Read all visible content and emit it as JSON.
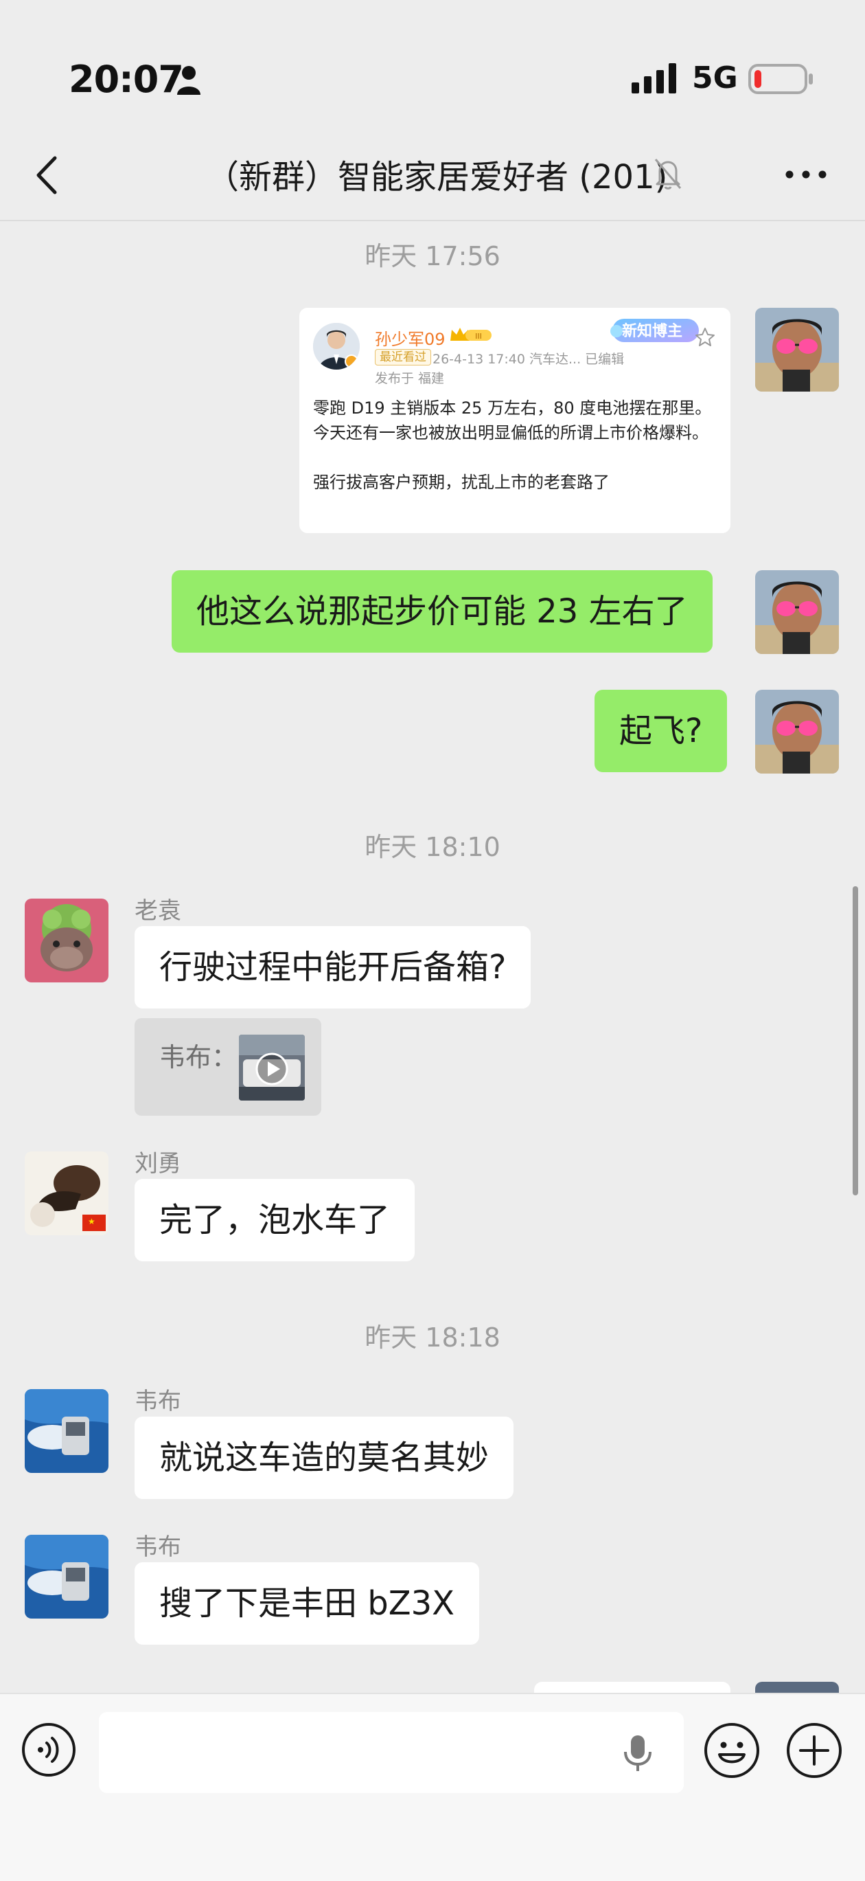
{
  "status_bar": {
    "time": "20:07",
    "network": "5G"
  },
  "header": {
    "title": "（新群）智能家居爱好者 (201)"
  },
  "messages": {
    "ts1": "昨天 17:56",
    "ts2": "昨天 18:10",
    "ts3": "昨天 18:18",
    "shared_post": {
      "author": "孙少军09",
      "badge": "新知博主",
      "tag": "最近看过",
      "meta": "26-4-13 17:40 汽车达... 已编辑",
      "location": "发布于 福建",
      "line1": "零跑 D19 主销版本 25 万左右，80 度电池摆在那里。",
      "line2": "今天还有一家也被放出明显偏低的所谓上市价格爆料。",
      "line3": "强行拔高客户预期，扰乱上市的老套路了"
    },
    "me1": "他这么说那起步价可能 23 左右了",
    "me2": "起飞?",
    "laoyuan_name": "老袁",
    "laoyuan_msg": "行驶过程中能开后备箱?",
    "quote_label": "韦布：",
    "liuyong_name": "刘勇",
    "liuyong_msg": "完了，泡水车了",
    "weibu_name1": "韦布",
    "weibu_msg1": "就说这车造的莫名其妙",
    "weibu_name2": "韦布",
    "weibu_msg2": "搜了下是丰田 bZ3X"
  },
  "input": {
    "placeholder": ""
  },
  "icons": {
    "back": "chevron-left-icon",
    "mute": "bell-slash-icon",
    "more": "ellipsis-icon",
    "voice": "voice-icon",
    "mic": "microphone-icon",
    "emoji": "emoji-icon",
    "plus": "plus-icon"
  },
  "colors": {
    "my_bubble": "#95ec69",
    "background": "#ededed"
  }
}
